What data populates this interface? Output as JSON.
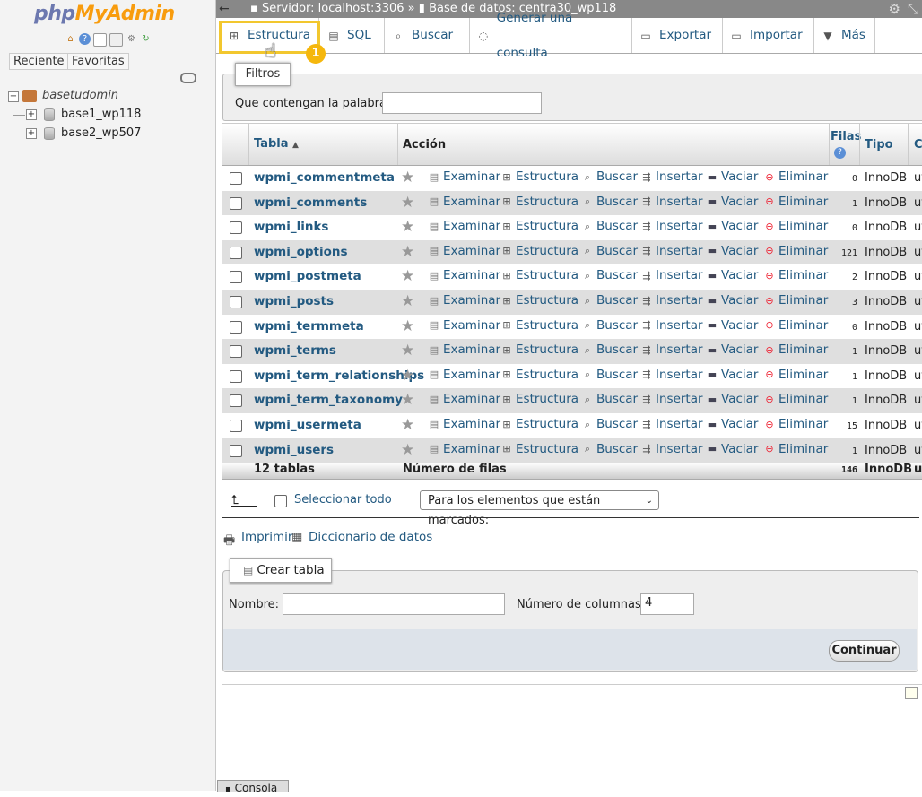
{
  "sidebar": {
    "logo_php": "php",
    "logo_myadmin": "MyAdmin",
    "tab_recent": "Reciente",
    "tab_favorites": "Favoritas",
    "tree": {
      "root": "basetudomin",
      "children": [
        "base1_wp118",
        "base2_wp507"
      ]
    }
  },
  "topbar": {
    "server": "Servidor: localhost:3306",
    "sep": "»",
    "database": "Base de datos: centra30_wp118"
  },
  "tabs": [
    "Estructura",
    "SQL",
    "Buscar",
    "Generar una consulta",
    "Exportar",
    "Importar",
    "Más"
  ],
  "callout": {
    "step": "1",
    "tooltip": "Filtros"
  },
  "filter": {
    "label": "Que contengan la palabra:",
    "value": ""
  },
  "table": {
    "headers": {
      "name": "Tabla",
      "action": "Acción",
      "rows": "Filas",
      "type": "Tipo",
      "coll": "C"
    },
    "actions": [
      "Examinar",
      "Estructura",
      "Buscar",
      "Insertar",
      "Vaciar",
      "Eliminar"
    ],
    "rows": [
      {
        "name": "wpmi_commentmeta",
        "rows": "0",
        "engine": "InnoDB",
        "coll": "ut"
      },
      {
        "name": "wpmi_comments",
        "rows": "1",
        "engine": "InnoDB",
        "coll": "ut"
      },
      {
        "name": "wpmi_links",
        "rows": "0",
        "engine": "InnoDB",
        "coll": "ut"
      },
      {
        "name": "wpmi_options",
        "rows": "121",
        "engine": "InnoDB",
        "coll": "ut"
      },
      {
        "name": "wpmi_postmeta",
        "rows": "2",
        "engine": "InnoDB",
        "coll": "ut"
      },
      {
        "name": "wpmi_posts",
        "rows": "3",
        "engine": "InnoDB",
        "coll": "ut"
      },
      {
        "name": "wpmi_termmeta",
        "rows": "0",
        "engine": "InnoDB",
        "coll": "ut"
      },
      {
        "name": "wpmi_terms",
        "rows": "1",
        "engine": "InnoDB",
        "coll": "ut"
      },
      {
        "name": "wpmi_term_relationships",
        "rows": "1",
        "engine": "InnoDB",
        "coll": "ut"
      },
      {
        "name": "wpmi_term_taxonomy",
        "rows": "1",
        "engine": "InnoDB",
        "coll": "ut"
      },
      {
        "name": "wpmi_usermeta",
        "rows": "15",
        "engine": "InnoDB",
        "coll": "ut"
      },
      {
        "name": "wpmi_users",
        "rows": "1",
        "engine": "InnoDB",
        "coll": "ut"
      }
    ],
    "footer": {
      "count": "12 tablas",
      "label": "Número de filas",
      "total": "146",
      "engine": "InnoDB",
      "coll": "ut"
    }
  },
  "bulk": {
    "select_all": "Seleccionar todo",
    "with_selected": "Para los elementos que están marcados:"
  },
  "links": {
    "print": "Imprimir",
    "dictionary": "Diccionario de datos"
  },
  "create": {
    "legend": "Crear tabla",
    "name_label": "Nombre:",
    "name_value": "",
    "cols_label": "Número de columnas:",
    "cols_value": "4",
    "submit": "Continuar"
  },
  "console": {
    "label": "Consola"
  }
}
